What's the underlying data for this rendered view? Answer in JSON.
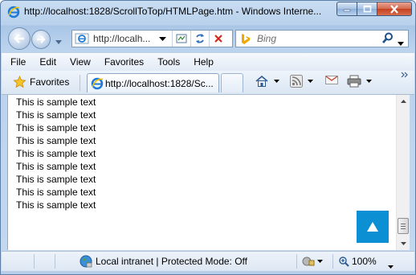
{
  "window": {
    "title": "http://localhost:1828/ScrollToTop/HTMLPage.htm - Windows Interne..."
  },
  "address_bar": {
    "url": "http://localh...",
    "search_placeholder": "Bing"
  },
  "menu": {
    "items": [
      "File",
      "Edit",
      "View",
      "Favorites",
      "Tools",
      "Help"
    ]
  },
  "favorites_bar": {
    "favorites_label": "Favorites",
    "tab_title": "http://localhost:1828/Sc..."
  },
  "page": {
    "lines": [
      "This is sample text",
      "This is sample text",
      "This is sample text",
      "This is sample text",
      "This is sample text",
      "This is sample text",
      "This is sample text",
      "This is sample text",
      "This is sample text"
    ],
    "scroll_top_button_color": "#0d8fd4"
  },
  "status_bar": {
    "zone": "Local intranet | Protected Mode: Off",
    "zoom": "100%"
  },
  "icons": [
    "ie-icon",
    "back-icon",
    "forward-icon",
    "compat-icon",
    "refresh-icon",
    "stop-icon",
    "bing-icon",
    "search-icon",
    "star-icon",
    "home-icon",
    "rss-icon",
    "mail-icon",
    "print-icon",
    "globe-icon",
    "security-icon",
    "zoom-icon"
  ]
}
